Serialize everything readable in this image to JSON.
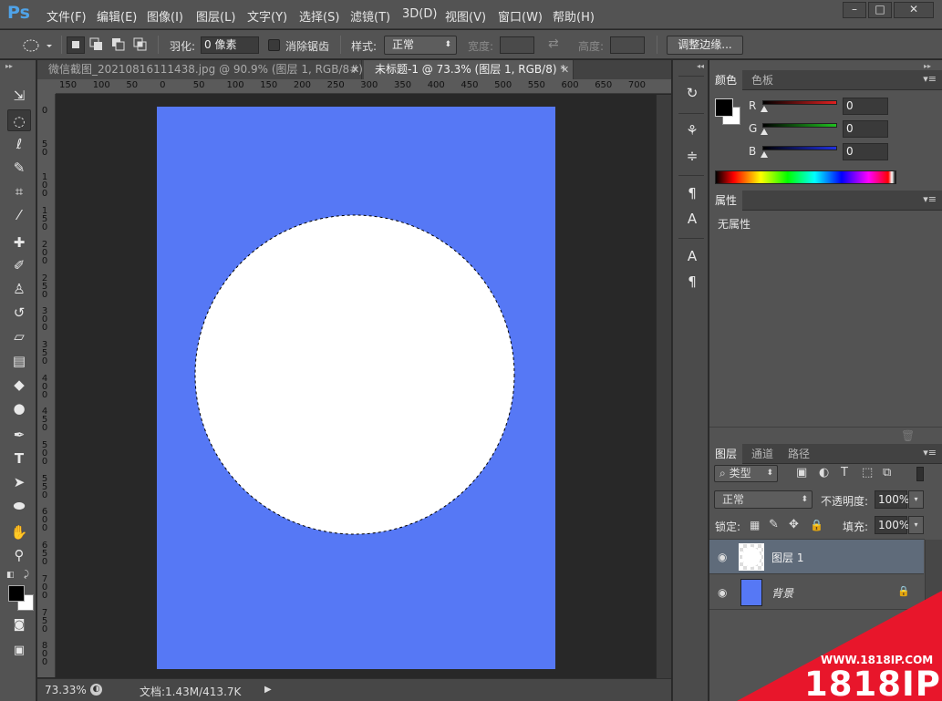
{
  "app": {
    "logo": "Ps"
  },
  "menu": [
    "文件(F)",
    "编辑(E)",
    "图像(I)",
    "图层(L)",
    "文字(Y)",
    "选择(S)",
    "滤镜(T)",
    "3D(D)",
    "视图(V)",
    "窗口(W)",
    "帮助(H)"
  ],
  "window_buttons": {
    "minimize": "–",
    "restore": "□",
    "close": "✕"
  },
  "options": {
    "feather_label": "羽化:",
    "feather_value": "0 像素",
    "antialias_label": "消除锯齿",
    "style_label": "样式:",
    "style_value": "正常",
    "width_label": "宽度:",
    "height_label": "高度:",
    "refine_edge": "调整边缘..."
  },
  "tabs": [
    {
      "label": "微信截图_20210816111438.jpg @ 90.9% (图层 1, RGB/8#) *",
      "active": false
    },
    {
      "label": "未标题-1 @ 73.3% (图层 1, RGB/8) *",
      "active": true
    }
  ],
  "ruler_h": [
    "150",
    "100",
    "50",
    "0",
    "50",
    "100",
    "150",
    "200",
    "250",
    "300",
    "350",
    "400",
    "450",
    "500",
    "550",
    "600",
    "650",
    "700"
  ],
  "ruler_v": [
    "0",
    "5 0",
    "1 0 0",
    "1 5 0",
    "2 0 0",
    "2 5 0",
    "3 0 0",
    "3 5 0",
    "4 0 0",
    "4 5 0",
    "5 0 0",
    "5 5 0",
    "6 0 0",
    "6 5 0",
    "7 0 0",
    "7 5 0",
    "8 0 0"
  ],
  "status": {
    "zoom": "73.33%",
    "doc": "文档:1.43M/413.7K"
  },
  "colors": {
    "canvas_fill": "#5678f5",
    "selection_fill": "#ffffff",
    "foreground": "#000000",
    "background": "#ffffff"
  },
  "color_panel": {
    "tabs": [
      "颜色",
      "色板"
    ],
    "channels": [
      {
        "name": "R",
        "value": "0",
        "color": "#e02020"
      },
      {
        "name": "G",
        "value": "0",
        "color": "#20c020"
      },
      {
        "name": "B",
        "value": "0",
        "color": "#2030e0"
      }
    ]
  },
  "properties_panel": {
    "tab": "属性",
    "text": "无属性"
  },
  "layers_panel": {
    "tabs": [
      "图层",
      "通道",
      "路径"
    ],
    "filter_label": "类型",
    "blend_mode": "正常",
    "opacity_label": "不透明度:",
    "opacity_value": "100%",
    "lock_label": "锁定:",
    "fill_label": "填充:",
    "fill_value": "100%",
    "layers": [
      {
        "name": "图层 1",
        "selected": true
      },
      {
        "name": "背景",
        "selected": false,
        "locked": true
      }
    ]
  },
  "watermark": {
    "url": "WWW.1818IP.COM",
    "brand": "1818IP"
  }
}
